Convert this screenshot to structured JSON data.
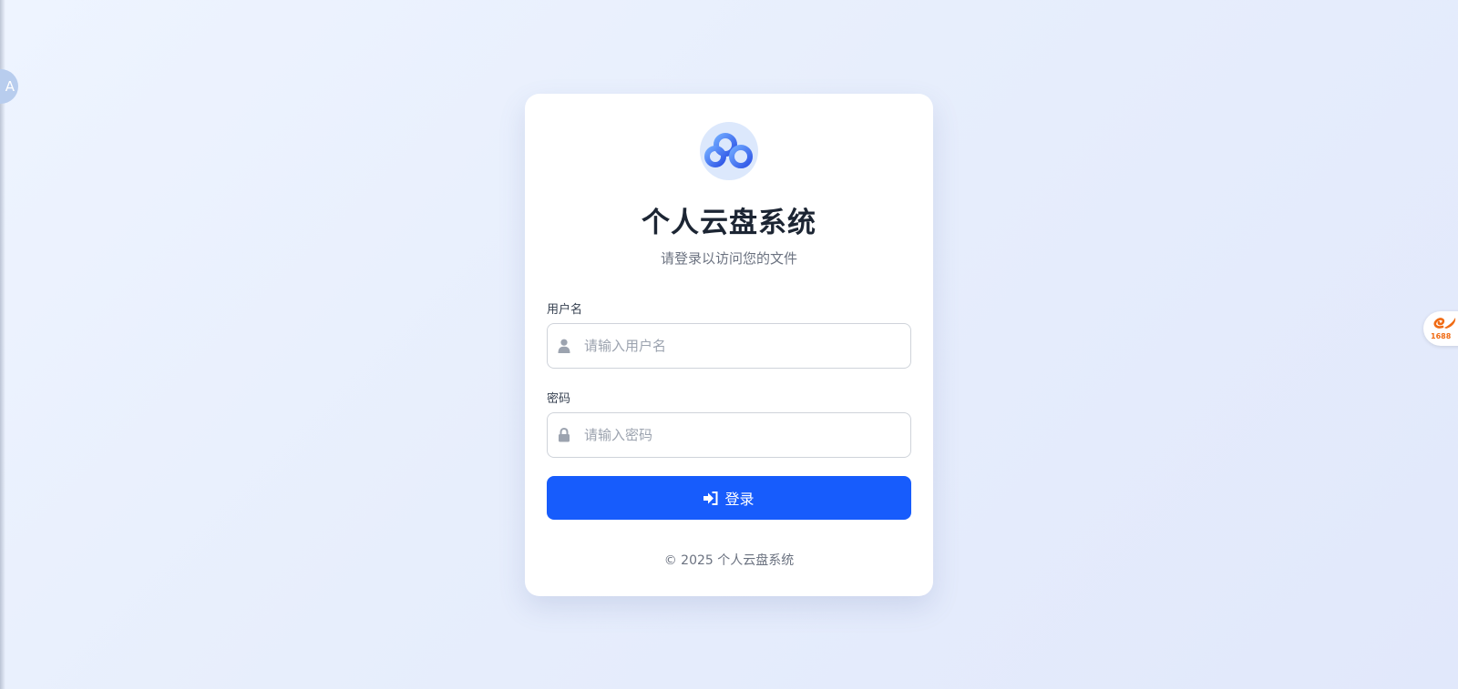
{
  "app": {
    "title": "个人云盘系统",
    "subtitle": "请登录以访问您的文件",
    "logo_icon": "cloud-icon"
  },
  "form": {
    "username": {
      "label": "用户名",
      "placeholder": "请输入用户名",
      "value": "",
      "icon": "user-icon"
    },
    "password": {
      "label": "密码",
      "placeholder": "请输入密码",
      "value": "",
      "icon": "lock-icon"
    },
    "submit": {
      "label": "登录",
      "icon": "sign-in-icon"
    }
  },
  "footer": {
    "text": "© 2025 个人云盘系统"
  },
  "widgets": {
    "left_float_text": "A",
    "right_float_text": "1688",
    "right_float_icon": "alibaba-1688-icon"
  },
  "colors": {
    "accent": "#175cfc",
    "logo_gradient_start": "#6ea8ff",
    "logo_gradient_end": "#2f55e6",
    "background": "#e7eefc"
  }
}
